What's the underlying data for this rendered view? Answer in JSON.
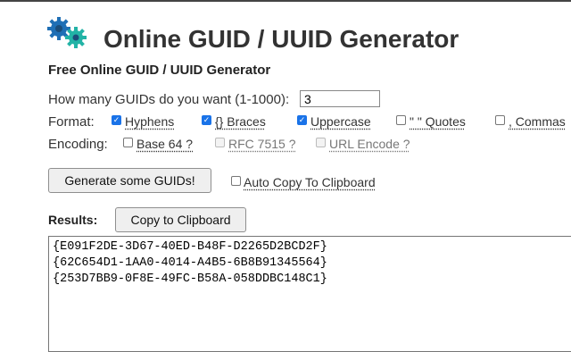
{
  "header": {
    "title": "Online GUID / UUID Generator",
    "subtitle": "Free Online GUID / UUID Generator"
  },
  "form": {
    "count_label": "How many GUIDs do you want (1-1000):",
    "count_value": "3",
    "format_label": "Format:",
    "encoding_label": "Encoding:",
    "format_options": [
      {
        "label": "Hyphens",
        "checked": true
      },
      {
        "label": "{} Braces",
        "checked": true
      },
      {
        "label": "Uppercase",
        "checked": true
      },
      {
        "label": "\" \" Quotes",
        "checked": false
      },
      {
        "label": ", Commas",
        "checked": false
      }
    ],
    "encoding_options": [
      {
        "label": "Base 64 ?",
        "checked": false,
        "disabled": false
      },
      {
        "label": "RFC 7515 ?",
        "checked": false,
        "disabled": true
      },
      {
        "label": "URL Encode ?",
        "checked": false,
        "disabled": true
      }
    ],
    "generate_label": "Generate some GUIDs!",
    "auto_copy_label": "Auto Copy To Clipboard",
    "auto_copy_checked": false
  },
  "results": {
    "label": "Results:",
    "copy_label": "Copy to Clipboard",
    "guids": [
      "{E091F2DE-3D67-40ED-B48F-D2265D2BCD2F}",
      "{62C654D1-1AA0-4014-A4B5-6B8B91345564}",
      "{253D7BB9-0F8E-49FC-B58A-058DDBC148C1}"
    ]
  },
  "colors": {
    "checkbox_checked": "#1a73e8",
    "gear_blue": "#1f6fb5",
    "gear_teal": "#22b3a6",
    "gear_dark": "#1b4d7a"
  }
}
